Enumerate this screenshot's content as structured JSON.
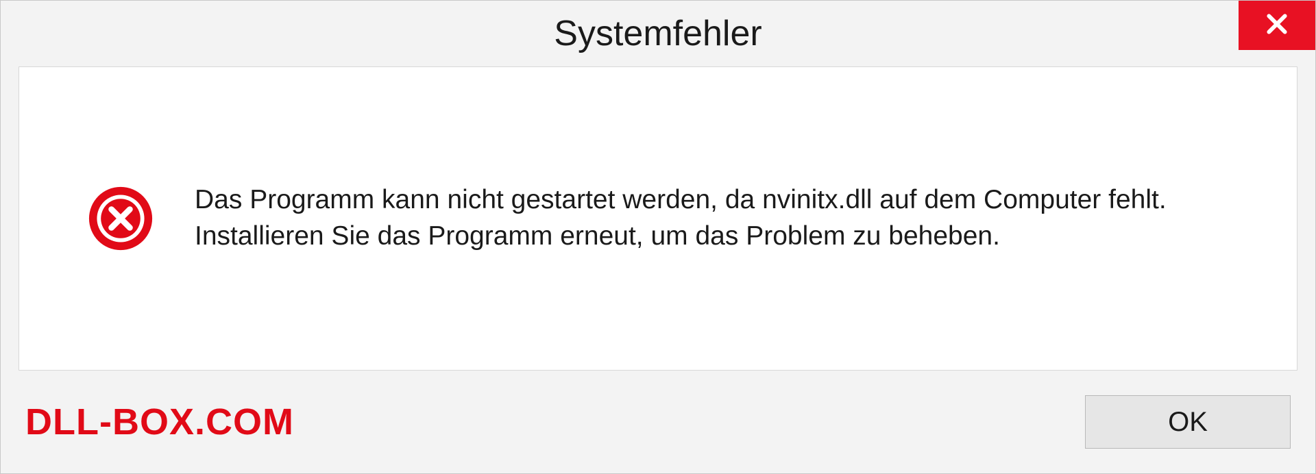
{
  "dialog": {
    "title": "Systemfehler",
    "message": "Das Programm kann nicht gestartet werden, da nvinitx.dll auf dem Computer fehlt. Installieren Sie das Programm erneut, um das Problem zu beheben.",
    "ok_label": "OK"
  },
  "watermark": "DLL-BOX.COM",
  "colors": {
    "close_bg": "#e81123",
    "error_icon": "#e10a17",
    "watermark": "#e10a17"
  }
}
